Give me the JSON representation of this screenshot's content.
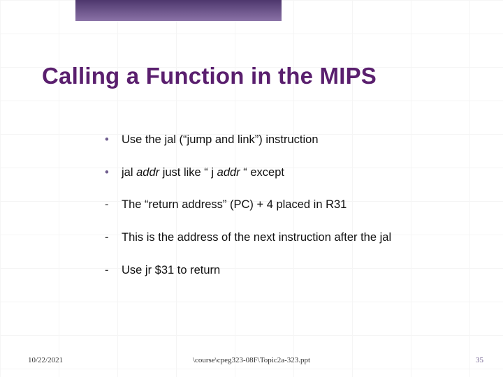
{
  "title": "Calling a Function in the MIPS",
  "bullets": [
    {
      "marker": "•",
      "kind": "dot",
      "text": "Use the jal (“jump and link”) instruction"
    },
    {
      "marker": "•",
      "kind": "dot",
      "text_pre": "jal ",
      "text_ital": "addr",
      "text_mid": " just like “ j ",
      "text_ital2": "addr",
      "text_post": " “ except"
    },
    {
      "marker": "-",
      "kind": "dash",
      "text": "The “return address” (PC) + 4 placed in R31"
    },
    {
      "marker": "-",
      "kind": "dash",
      "text": "This is the address of the next instruction after the jal"
    },
    {
      "marker": "-",
      "kind": "dash",
      "text": "Use jr $31 to return"
    }
  ],
  "footer": {
    "date": "10/22/2021",
    "path": "\\course\\cpeg323-08F\\Topic2a-323.ppt",
    "page": "35"
  }
}
